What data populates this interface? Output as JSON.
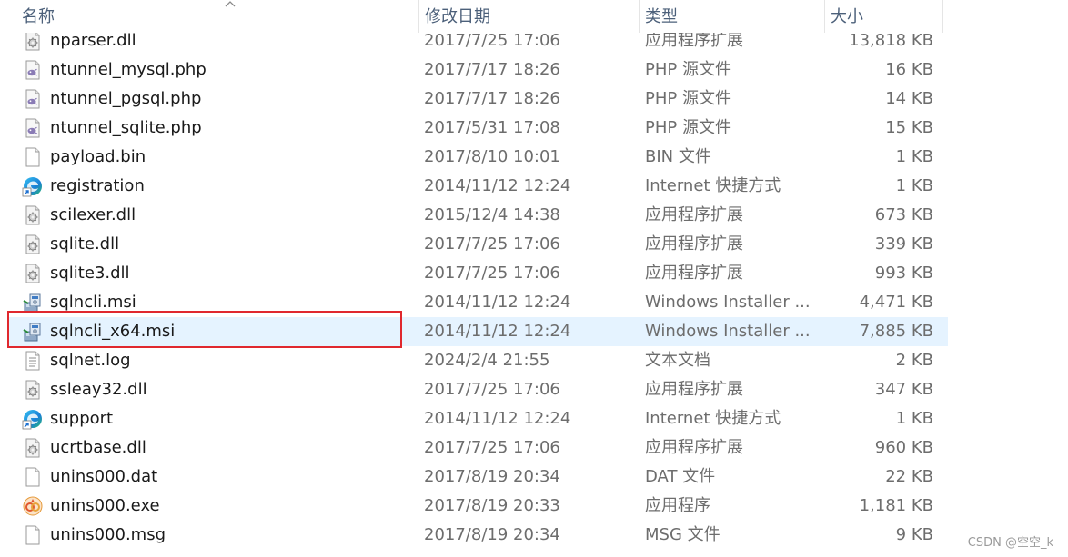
{
  "columns": {
    "name": "名称",
    "date": "修改日期",
    "type": "类型",
    "size": "大小"
  },
  "files": [
    {
      "name": "nparser.dll",
      "date": "2017/7/25 17:06",
      "type": "应用程序扩展",
      "size": "13,818 KB",
      "icon": "dll-gear-icon"
    },
    {
      "name": "ntunnel_mysql.php",
      "date": "2017/7/17 18:26",
      "type": "PHP 源文件",
      "size": "16 KB",
      "icon": "php-file-icon"
    },
    {
      "name": "ntunnel_pgsql.php",
      "date": "2017/7/17 18:26",
      "type": "PHP 源文件",
      "size": "14 KB",
      "icon": "php-file-icon"
    },
    {
      "name": "ntunnel_sqlite.php",
      "date": "2017/5/31 17:08",
      "type": "PHP 源文件",
      "size": "15 KB",
      "icon": "php-file-icon"
    },
    {
      "name": "payload.bin",
      "date": "2017/8/10 10:01",
      "type": "BIN 文件",
      "size": "1 KB",
      "icon": "blank-file-icon"
    },
    {
      "name": "registration",
      "date": "2014/11/12 12:24",
      "type": "Internet 快捷方式",
      "size": "1 KB",
      "icon": "edge-shortcut-icon"
    },
    {
      "name": "scilexer.dll",
      "date": "2015/12/4 14:38",
      "type": "应用程序扩展",
      "size": "673 KB",
      "icon": "dll-gear-icon"
    },
    {
      "name": "sqlite.dll",
      "date": "2017/7/25 17:06",
      "type": "应用程序扩展",
      "size": "339 KB",
      "icon": "dll-gear-icon"
    },
    {
      "name": "sqlite3.dll",
      "date": "2017/7/25 17:06",
      "type": "应用程序扩展",
      "size": "993 KB",
      "icon": "dll-gear-icon"
    },
    {
      "name": "sqlncli.msi",
      "date": "2014/11/12 12:24",
      "type": "Windows Installer ...",
      "size": "4,471 KB",
      "icon": "msi-installer-icon"
    },
    {
      "name": "sqlncli_x64.msi",
      "date": "2014/11/12 12:24",
      "type": "Windows Installer ...",
      "size": "7,885 KB",
      "icon": "msi-installer-icon",
      "selected": true
    },
    {
      "name": "sqlnet.log",
      "date": "2024/2/4 21:55",
      "type": "文本文档",
      "size": "2 KB",
      "icon": "text-file-icon"
    },
    {
      "name": "ssleay32.dll",
      "date": "2017/7/25 17:06",
      "type": "应用程序扩展",
      "size": "347 KB",
      "icon": "dll-gear-icon"
    },
    {
      "name": "support",
      "date": "2014/11/12 12:24",
      "type": "Internet 快捷方式",
      "size": "1 KB",
      "icon": "edge-shortcut-icon"
    },
    {
      "name": "ucrtbase.dll",
      "date": "2017/7/25 17:06",
      "type": "应用程序扩展",
      "size": "960 KB",
      "icon": "dll-gear-icon"
    },
    {
      "name": "unins000.dat",
      "date": "2017/8/19 20:34",
      "type": "DAT 文件",
      "size": "22 KB",
      "icon": "blank-file-icon"
    },
    {
      "name": "unins000.exe",
      "date": "2017/8/19 20:33",
      "type": "应用程序",
      "size": "1,181 KB",
      "icon": "uninstaller-app-icon"
    },
    {
      "name": "unins000.msg",
      "date": "2017/8/19 20:34",
      "type": "MSG 文件",
      "size": "9 KB",
      "icon": "blank-file-icon"
    }
  ],
  "watermark": "CSDN @空空_k",
  "colors": {
    "selected_bg": "#e5f3ff",
    "highlight_border": "#e0282e",
    "header_text": "#4c607a"
  }
}
